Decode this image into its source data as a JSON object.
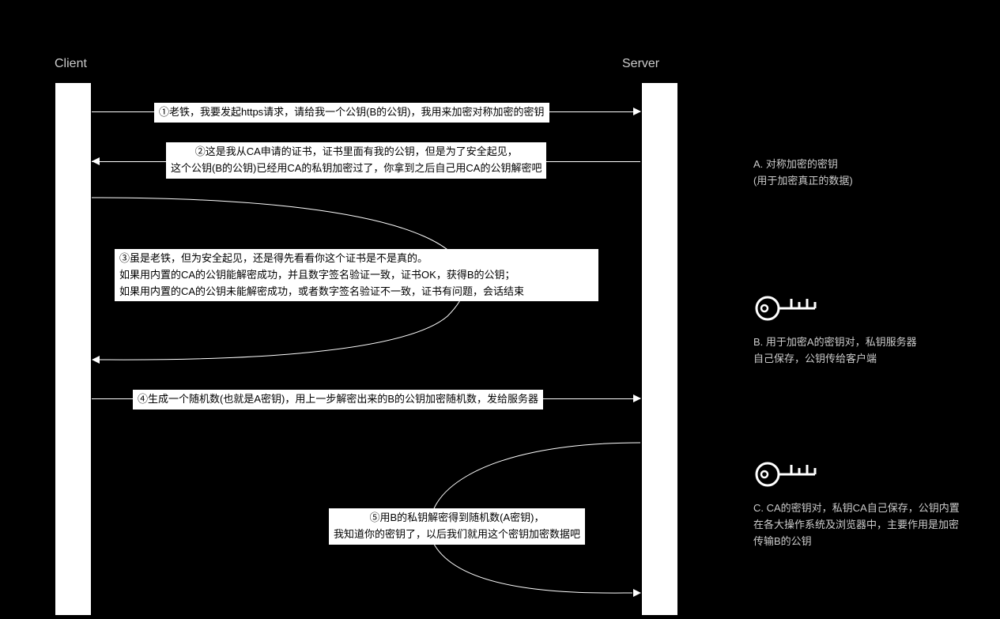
{
  "participants": {
    "client": "Client",
    "server": "Server"
  },
  "messages": {
    "m1": "①老铁，我要发起https请求，请给我一个公钥(B的公钥)，我用来加密对称加密的密钥",
    "m2_line1": "②这是我从CA申请的证书，证书里面有我的公钥，但是为了安全起见，",
    "m2_line2": "这个公钥(B的公钥)已经用CA的私钥加密过了，你拿到之后自己用CA的公钥解密吧",
    "m3_line1": "③虽是老铁，但为安全起见，还是得先看看你这个证书是不是真的。",
    "m3_line2": "如果用内置的CA的公钥能解密成功，并且数字签名验证一致，证书OK，获得B的公钥；",
    "m3_line3": "如果用内置的CA的公钥未能解密成功，或者数字签名验证不一致，证书有问题，会话结束",
    "m4": "④生成一个随机数(也就是A密钥)，用上一步解密出来的B的公钥加密随机数，发给服务器",
    "m5_line1": "⑤用B的私钥解密得到随机数(A密钥)，",
    "m5_line2": "我知道你的密钥了，以后我们就用这个密钥加密数据吧"
  },
  "legend": {
    "a_line1": "A. 对称加密的密钥",
    "a_line2": "(用于加密真正的数据)",
    "b_line1": "B. 用于加密A的密钥对，私钥服务器",
    "b_line2": "自己保存，公钥传给客户端",
    "c_line1": "C. CA的密钥对，私钥CA自己保存，公钥内置",
    "c_line2": "在各大操作系统及浏览器中，主要作用是加密",
    "c_line3": "传输B的公钥"
  }
}
